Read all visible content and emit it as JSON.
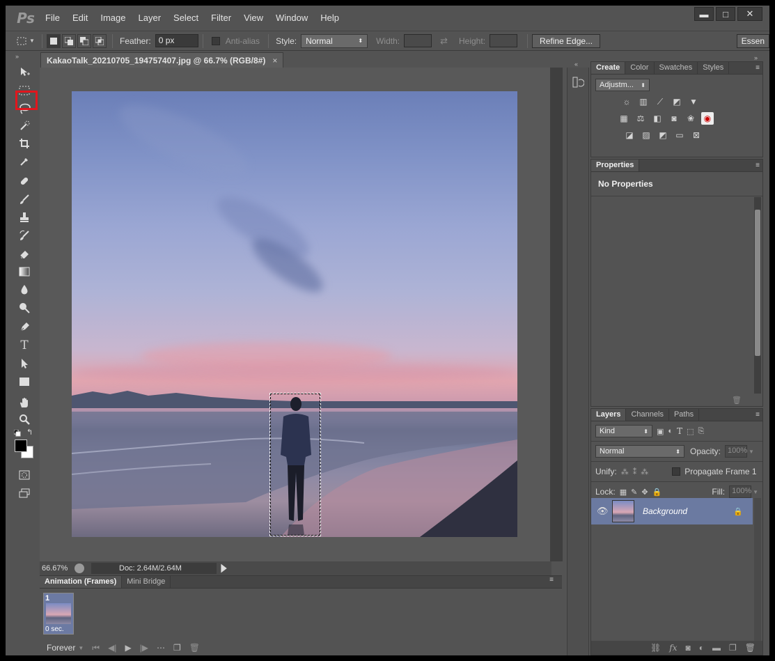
{
  "app": {
    "logo": "Ps"
  },
  "menu": [
    "File",
    "Edit",
    "Image",
    "Layer",
    "Select",
    "Filter",
    "View",
    "Window",
    "Help"
  ],
  "window_controls": {
    "minimize": "▬",
    "maximize": "□",
    "close": "✕"
  },
  "options": {
    "feather_label": "Feather:",
    "feather_value": "0 px",
    "antialias_label": "Anti-alias",
    "style_label": "Style:",
    "style_value": "Normal",
    "width_label": "Width:",
    "height_label": "Height:",
    "refine_edge": "Refine Edge...",
    "workspace": "Essen"
  },
  "document": {
    "tab_title": "KakaoTalk_20210705_194757407.jpg @ 66.7% (RGB/8#)",
    "close_glyph": "×"
  },
  "status": {
    "zoom": "66.67%",
    "doc": "Doc: 2.64M/2.64M"
  },
  "animation": {
    "tabs": [
      "Animation (Frames)",
      "Mini Bridge"
    ],
    "frame_number": "1",
    "frame_delay": "0 sec.",
    "loop": "Forever"
  },
  "adjust_panel": {
    "tabs": [
      "Create",
      "Color",
      "Swatches",
      "Styles"
    ],
    "select": "Adjustm..."
  },
  "properties": {
    "tab": "Properties",
    "body": "No Properties"
  },
  "layers": {
    "tabs": [
      "Layers",
      "Channels",
      "Paths"
    ],
    "kind": "Kind",
    "blend": "Normal",
    "opacity_label": "Opacity:",
    "opacity_value": "100%",
    "unify_label": "Unify:",
    "propagate_label": "Propagate Frame 1",
    "lock_label": "Lock:",
    "fill_label": "Fill:",
    "fill_value": "100%",
    "layer_name": "Background"
  },
  "colors": {
    "accent_red": "#e2161d",
    "ui_bg": "#535353",
    "layer_selected": "#6b7aa1"
  }
}
